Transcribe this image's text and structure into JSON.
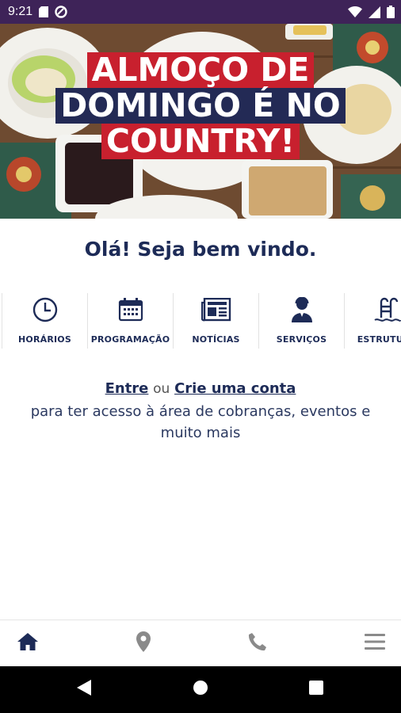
{
  "status_bar": {
    "time": "9:21",
    "icons": [
      "sd-card-icon",
      "data-saver-icon",
      "wifi-icon",
      "signal-icon",
      "battery-icon"
    ]
  },
  "hero": {
    "headline_lines": [
      "ALMOÇO DE",
      "DOMINGO É NO",
      "COUNTRY!"
    ],
    "colors": {
      "red": "#c8202e",
      "navy": "#232a55"
    }
  },
  "welcome": {
    "text": "Olá! Seja bem vindo."
  },
  "shortcuts": [
    {
      "label": "HORÁRIOS",
      "icon": "clock-icon"
    },
    {
      "label": "PROGRAMAÇÃO",
      "icon": "calendar-icon"
    },
    {
      "label": "NOTÍCIAS",
      "icon": "newspaper-icon"
    },
    {
      "label": "SERVIÇOS",
      "icon": "attendant-icon"
    },
    {
      "label": "ESTRUTURA",
      "icon": "pool-ladder-icon"
    }
  ],
  "login_prompt": {
    "login_link": "Entre",
    "connector": "ou",
    "signup_link": "Crie uma conta",
    "description": "para ter acesso à área de cobranças, eventos e muito mais"
  },
  "bottom_nav": {
    "items": [
      "home-icon",
      "location-pin-icon",
      "phone-icon",
      "menu-icon"
    ],
    "active_color": "#1d2b57",
    "inactive_color": "#8a8a8a"
  },
  "system_nav": [
    "back-icon",
    "home-circle-icon",
    "recents-icon"
  ]
}
